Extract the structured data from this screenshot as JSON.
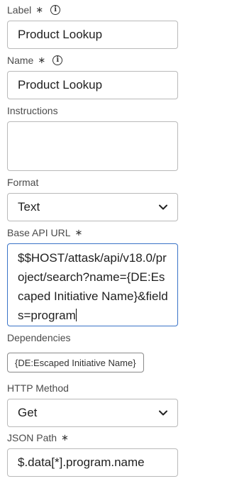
{
  "label_field": {
    "label": "Label",
    "required_mark": "∗",
    "value": "Product Lookup"
  },
  "name_field": {
    "label": "Name",
    "required_mark": "∗",
    "value": "Product Lookup"
  },
  "instructions_field": {
    "label": "Instructions",
    "value": ""
  },
  "format_field": {
    "label": "Format",
    "selected": "Text"
  },
  "base_api_url_field": {
    "label": "Base API URL",
    "required_mark": "∗",
    "value": "$$HOST/attask/api/v18.0/project/search?name={DE:Escaped Initiative Name}&fields=program"
  },
  "dependencies_field": {
    "label": "Dependencies",
    "chip": "{DE:Escaped Initiative Name}"
  },
  "http_method_field": {
    "label": "HTTP Method",
    "selected": "Get"
  },
  "json_path_field": {
    "label": "JSON Path",
    "required_mark": "∗",
    "value": "$.data[*].program.name"
  },
  "icons": {
    "info": "info-icon",
    "chevron": "chevron-down-icon"
  },
  "colors": {
    "focus_border": "#3a73c7",
    "field_border": "#b9b9b9"
  }
}
